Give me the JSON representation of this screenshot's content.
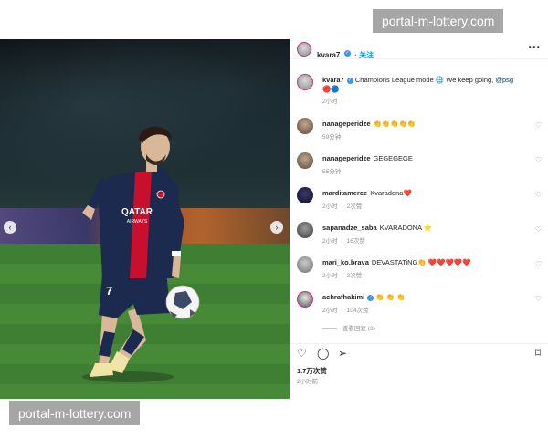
{
  "watermark_top": "portal-m-lottery.com",
  "watermark_bottom": "portal-m-lottery.com",
  "post": {
    "author": "kvara7",
    "follow_label": "· 关注",
    "caption": {
      "user": "kvara7",
      "text": "Champions League mode 🌐 We keep going,",
      "mention": "@psg",
      "emojis": "🔴🔵",
      "time": "2小时"
    },
    "comments": [
      {
        "user": "nanageperidze",
        "text": "👏👏👏👏👏",
        "time": "59分钟",
        "likes": ""
      },
      {
        "user": "nanageperidze",
        "text": "GEGEGEGE",
        "time": "55分钟",
        "likes": ""
      },
      {
        "user": "marditamerce",
        "text": "Kvaradona❤️",
        "time": "2小时",
        "likes": "2次赞"
      },
      {
        "user": "sapanadze_saba",
        "text": "KVARADONA ⭐",
        "time": "2小时",
        "likes": "16次赞"
      },
      {
        "user": "mari_ko.brava",
        "text": "DEVASTATiNG👏 ❤️❤️❤️❤️❤️",
        "time": "2小时",
        "likes": "3次赞"
      },
      {
        "user": "achrafhakimi",
        "text": "👏 👏 👏",
        "time": "2小时",
        "likes": "104次赞",
        "verified": true
      }
    ],
    "view_replies": "查看回复 (3)",
    "likes_count": "1.7万次赞",
    "posted_ago": "2小时前"
  },
  "colors": {
    "accent": "#0095f6",
    "verified": "#3897f0",
    "muted": "#8e8e8e",
    "jersey_navy": "#1b2a4e",
    "jersey_red": "#c8102e"
  },
  "icons": {
    "more": "more-options-icon",
    "like": "heart-icon",
    "comment": "comment-icon",
    "share": "send-icon",
    "save": "bookmark-icon"
  }
}
